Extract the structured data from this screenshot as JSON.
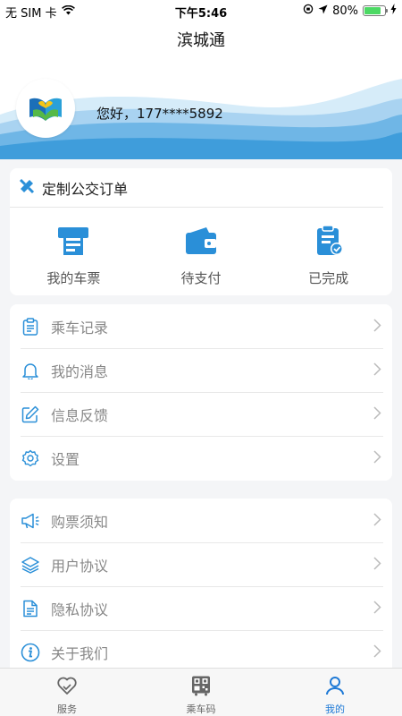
{
  "status_bar": {
    "carrier": "无 SIM 卡",
    "time": "下午5:46",
    "battery": "80%",
    "battery_level": 0.8
  },
  "header": {
    "title": "滨城通"
  },
  "profile": {
    "greeting": "您好，177****5892"
  },
  "order": {
    "title": "定制公交订单",
    "items": [
      {
        "label": "我的车票",
        "icon": "ticket-icon"
      },
      {
        "label": "待支付",
        "icon": "wallet-icon"
      },
      {
        "label": "已完成",
        "icon": "clipboard-check-icon"
      }
    ]
  },
  "menu1": [
    {
      "label": "乘车记录",
      "icon": "clipboard-icon"
    },
    {
      "label": "我的消息",
      "icon": "bell-icon"
    },
    {
      "label": "信息反馈",
      "icon": "edit-icon"
    },
    {
      "label": "设置",
      "icon": "gear-icon"
    }
  ],
  "menu2": [
    {
      "label": "购票须知",
      "icon": "megaphone-icon"
    },
    {
      "label": "用户协议",
      "icon": "layers-icon"
    },
    {
      "label": "隐私协议",
      "icon": "document-icon"
    },
    {
      "label": "关于我们",
      "icon": "info-icon"
    }
  ],
  "tabbar": {
    "tabs": [
      {
        "label": "服务",
        "icon": "heart-icon"
      },
      {
        "label": "乘车码",
        "icon": "bus-qr-icon"
      },
      {
        "label": "我的",
        "icon": "user-icon"
      }
    ],
    "active": 2
  },
  "colors": {
    "accent": "#1f7ad6",
    "wave_light": "#bfe0f5",
    "wave_dark": "#4aa3df",
    "icon_blue": "#2a8fd8"
  }
}
